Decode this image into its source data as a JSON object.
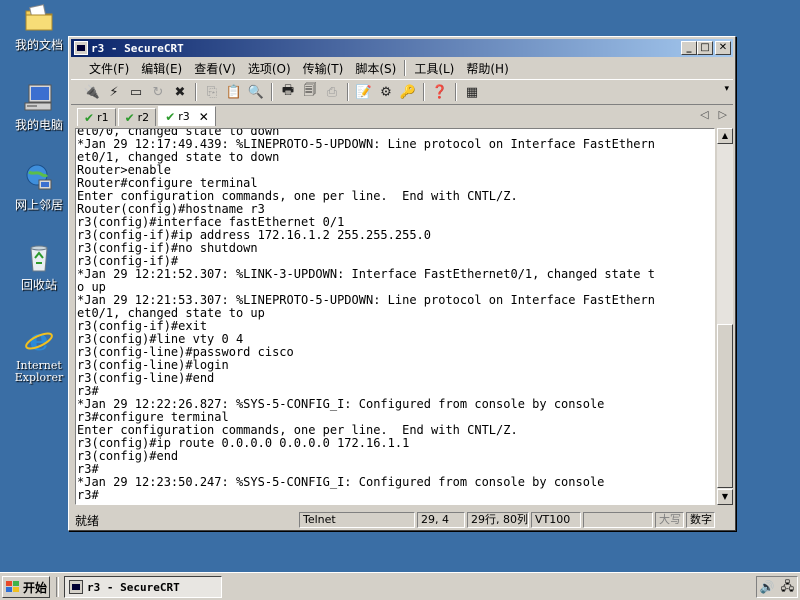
{
  "desktop": {
    "icons": [
      {
        "label": "我的文档",
        "icon": "my-documents-icon"
      },
      {
        "label": "我的电脑",
        "icon": "my-computer-icon"
      },
      {
        "label": "网上邻居",
        "icon": "network-places-icon"
      },
      {
        "label": "回收站",
        "icon": "recycle-bin-icon"
      },
      {
        "label": "Internet Explorer",
        "icon": "internet-explorer-icon"
      }
    ]
  },
  "window": {
    "title": "r3 - SecureCRT",
    "minimize": "_",
    "maximize": "□",
    "close": "✕"
  },
  "menu": {
    "file": "文件(F)",
    "edit": "编辑(E)",
    "view": "查看(V)",
    "options": "选项(O)",
    "transfer": "传输(T)",
    "script": "脚本(S)",
    "tools": "工具(L)",
    "help": "帮助(H)"
  },
  "tabs": [
    {
      "label": "r1",
      "status": "✔"
    },
    {
      "label": "r2",
      "status": "✔"
    },
    {
      "label": "r3",
      "status": "✔",
      "close": "✕"
    }
  ],
  "tab_nav": {
    "prev": "◁",
    "next": "▷"
  },
  "terminal": {
    "lines": [
      "et0/0, changed state to down",
      "*Jan 29 12:17:49.439: %LINEPROTO-5-UPDOWN: Line protocol on Interface FastEthern",
      "et0/1, changed state to down",
      "Router>enable",
      "Router#configure terminal",
      "Enter configuration commands, one per line.  End with CNTL/Z.",
      "Router(config)#hostname r3",
      "r3(config)#interface fastEthernet 0/1",
      "r3(config-if)#ip address 172.16.1.2 255.255.255.0",
      "r3(config-if)#no shutdown",
      "r3(config-if)#",
      "*Jan 29 12:21:52.307: %LINK-3-UPDOWN: Interface FastEthernet0/1, changed state t",
      "o up",
      "*Jan 29 12:21:53.307: %LINEPROTO-5-UPDOWN: Line protocol on Interface FastEthern",
      "et0/1, changed state to up",
      "r3(config-if)#exit",
      "r3(config)#line vty 0 4",
      "r3(config-line)#password cisco",
      "r3(config-line)#login",
      "r3(config-line)#end",
      "r3#",
      "*Jan 29 12:22:26.827: %SYS-5-CONFIG_I: Configured from console by console",
      "r3#configure terminal",
      "Enter configuration commands, one per line.  End with CNTL/Z.",
      "r3(config)#ip route 0.0.0.0 0.0.0.0 172.16.1.1",
      "r3(config)#end",
      "r3#",
      "*Jan 29 12:23:50.247: %SYS-5-CONFIG_I: Configured from console by console",
      "r3#"
    ]
  },
  "statusbar": {
    "ready": "就绪",
    "protocol": "Telnet",
    "cursor": "29,  4",
    "size": "29行, 80列",
    "emulation": "VT100",
    "caps": "大写",
    "num": "数字"
  },
  "taskbar": {
    "start": "开始",
    "task": "r3 - SecureCRT"
  }
}
